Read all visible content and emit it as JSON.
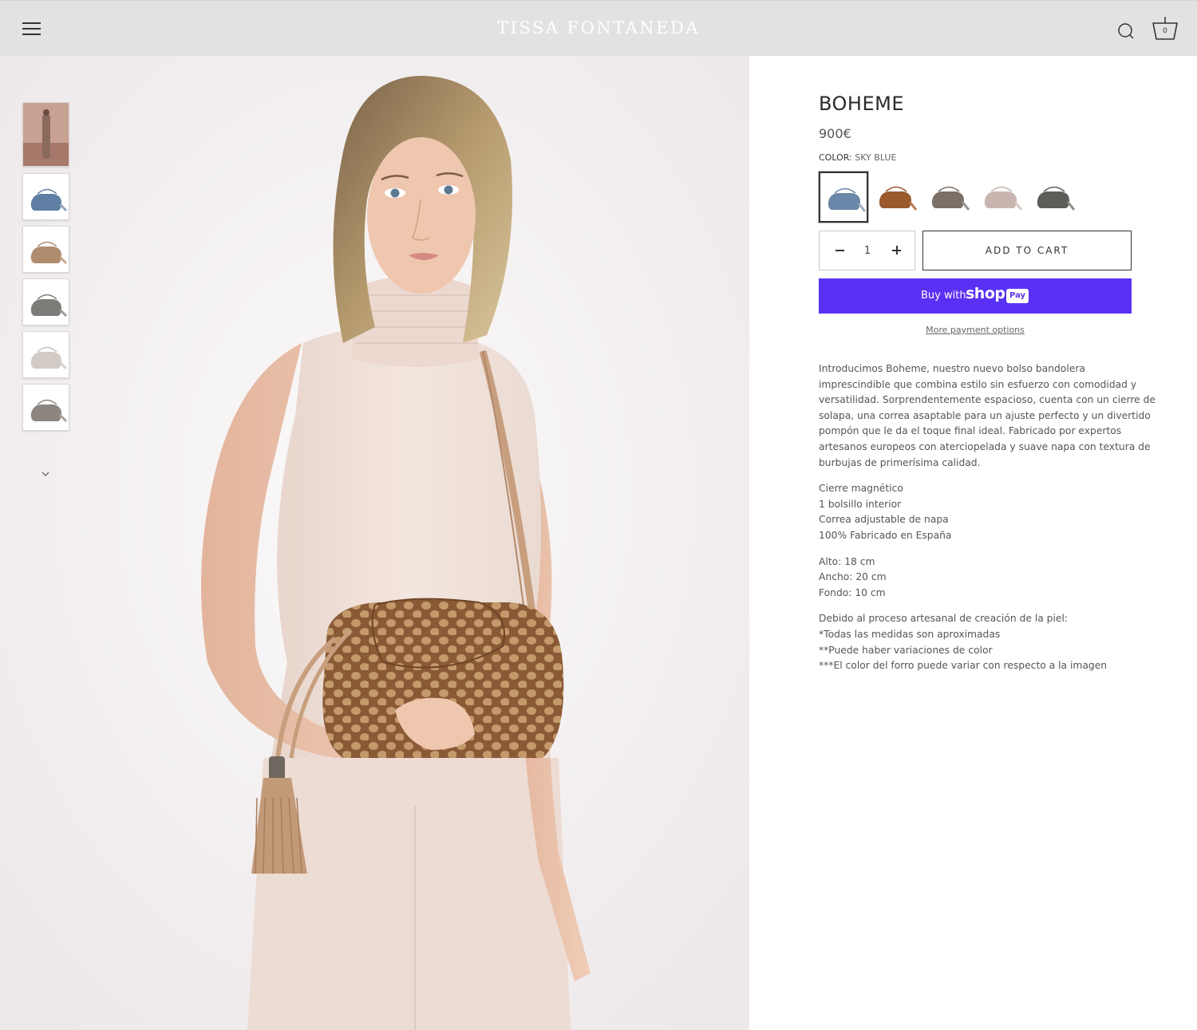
{
  "header": {
    "logo": "TISSA FONTANEDA",
    "cart_count": "0"
  },
  "product": {
    "title": "BOHEME",
    "price": "900€",
    "color_label": "COLOR:",
    "color_value": "SKY BLUE",
    "swatches": [
      {
        "name": "sky-blue",
        "color": "#6a86a8",
        "selected": true
      },
      {
        "name": "cognac",
        "color": "#9a5a2e",
        "selected": false
      },
      {
        "name": "taupe",
        "color": "#7a7068",
        "selected": false
      },
      {
        "name": "rose",
        "color": "#c9b5b0",
        "selected": false
      },
      {
        "name": "dark-grey",
        "color": "#5c5e5a",
        "selected": false
      }
    ],
    "quantity": "1",
    "add_to_cart": "ADD TO CART",
    "buy_with": "Buy with",
    "shop_word": "shop",
    "pay_word": "Pay",
    "more_payment": "More payment options"
  },
  "thumbnails": [
    {
      "name": "model-desert",
      "color": "#b48a78"
    },
    {
      "name": "bag-blue",
      "color": "#5e7ea4"
    },
    {
      "name": "bag-tan",
      "color": "#b08c6e"
    },
    {
      "name": "bag-grey",
      "color": "#7a7d78"
    },
    {
      "name": "bag-cream",
      "color": "#d3cbc6"
    },
    {
      "name": "bag-taupe",
      "color": "#8c8580"
    }
  ],
  "description": {
    "intro": [
      "Introducimos Boheme, nuestro nuevo bolso bandolera",
      "imprescindible que combina estilo sin esfuerzo con comodidad y",
      "versatilidad. Sorprendentemente espacioso, cuenta con un cierre de",
      "solapa, una correa asaptable para un ajuste perfecto y un divertido",
      "pompón que le da el toque final ideal. Fabricado por expertos",
      "artesanos europeos con aterciopelada y suave napa con textura de",
      "burbujas de primerísima calidad."
    ],
    "features": [
      "Cierre magnético",
      "1 bolsillo interior",
      "Correa adjustable de napa",
      "100% Fabricado en España"
    ],
    "dimensions": [
      "Alto: 18 cm",
      "Ancho: 20 cm",
      "Fondo: 10 cm"
    ],
    "notes": [
      "Debido al proceso artesanal de creación de la piel:",
      "*Todas las medidas son aproximadas",
      "**Puede haber variaciones de color",
      "***El color del forro puede variar con respecto a la imagen"
    ]
  }
}
